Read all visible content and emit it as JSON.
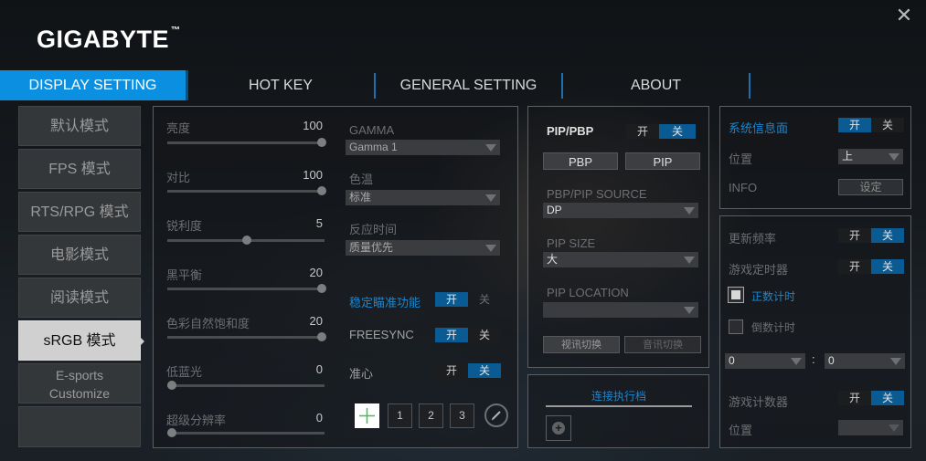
{
  "app": {
    "logo": "GIGABYTE",
    "logo_mark": "™",
    "close_glyph": "✕"
  },
  "tabs": [
    {
      "label": "DISPLAY SETTING",
      "active": true
    },
    {
      "label": "HOT KEY"
    },
    {
      "label": "GENERAL SETTING"
    },
    {
      "label": "ABOUT"
    }
  ],
  "sidebar": [
    {
      "label": "默认模式"
    },
    {
      "label": "FPS 模式"
    },
    {
      "label": "RTS/RPG 模式"
    },
    {
      "label": "电影模式"
    },
    {
      "label": "阅读模式"
    },
    {
      "label": "sRGB 模式",
      "active": true
    },
    {
      "label1": "E-sports",
      "label2": "Customize"
    },
    {
      "label": ""
    }
  ],
  "sliders": [
    {
      "label": "亮度",
      "value": "100",
      "level": 1.0
    },
    {
      "label": "对比",
      "value": "100",
      "level": 1.0
    },
    {
      "label": "锐利度",
      "value": "5",
      "level": 0.5
    },
    {
      "label": "黑平衡",
      "value": "20",
      "level": 1.0
    },
    {
      "label": "色彩自然饱和度",
      "value": "20",
      "level": 1.0
    },
    {
      "label": "低蓝光",
      "value": "0",
      "level": 0.0
    },
    {
      "label": "超级分辨率",
      "value": "0",
      "level": 0.0
    }
  ],
  "picture": {
    "gamma_label": "GAMMA",
    "gamma_value": "Gamma 1",
    "color_temp_label": "色温",
    "color_temp_value": "标准",
    "response_label": "反应时间",
    "response_value": "质量优先",
    "stabilizer_label": "稳定瞄准功能",
    "stabilizer_on": "开",
    "stabilizer_off": "关",
    "freesync_label": "FREESYNC",
    "freesync_on": "开",
    "freesync_off": "关",
    "crosshair_label": "准心",
    "crosshair_on": "开",
    "crosshair_off": "关",
    "crosshair_options": [
      "1",
      "2",
      "3"
    ]
  },
  "pip": {
    "title": "PIP/PBP",
    "on": "开",
    "off": "关",
    "pbp_button": "PBP",
    "pip_button": "PIP",
    "source_label": "PBP/PIP SOURCE",
    "source_value": "DP",
    "size_label": "PIP SIZE",
    "size_value": "大",
    "location_label": "PIP LOCATION",
    "location_value": "",
    "video_switch": "视讯切换",
    "audio_switch": "音讯切换"
  },
  "scheduler": {
    "label": "连接执行档",
    "add_glyph": "+"
  },
  "dashboard": {
    "label": "系统信息面",
    "on": "开",
    "off": "关",
    "position_label": "位置",
    "position_value": "上",
    "info_label": "INFO",
    "info_button": "设定"
  },
  "gaming": {
    "refresh_label": "更新频率",
    "refresh_on": "开",
    "refresh_off": "关",
    "timer_label": "游戏定时器",
    "timer_on": "开",
    "timer_off": "关",
    "count_up_label": "正数计时",
    "count_down_label": "倒数计时",
    "minutes_value": "0",
    "colon": ":",
    "seconds_value": "0",
    "counter_label": "游戏计数器",
    "counter_on": "开",
    "counter_off": "关",
    "counter_position_label": "位置",
    "counter_position_value": ""
  },
  "colors": {
    "accent": "#0b8fe0",
    "toggle_on": "#0a5b94",
    "link_blue": "#1a86cf"
  }
}
